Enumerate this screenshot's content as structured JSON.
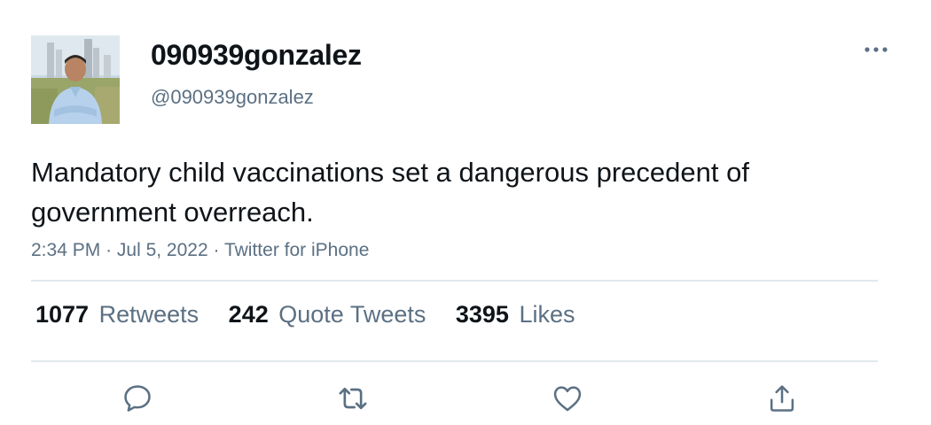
{
  "user": {
    "display_name": "090939gonzalez",
    "handle": "@090939gonzalez",
    "avatar_icon": "profile-photo"
  },
  "tweet": {
    "text": "Mandatory child vaccinations set a dangerous precedent of government overreach.",
    "time": "2:34 PM",
    "date": "Jul 5, 2022",
    "source": "Twitter for iPhone",
    "separator": "·"
  },
  "stats": {
    "retweets": {
      "count": "1077",
      "label": "Retweets"
    },
    "quotes": {
      "count": "242",
      "label": "Quote Tweets"
    },
    "likes": {
      "count": "3395",
      "label": "Likes"
    }
  },
  "actions": {
    "reply_icon": "reply-icon",
    "retweet_icon": "retweet-icon",
    "like_icon": "heart-icon",
    "share_icon": "share-icon",
    "more_icon": "more-icon"
  },
  "colors": {
    "text_primary": "#0f1419",
    "text_secondary": "#5b7083",
    "divider": "#e1e8ed",
    "icon": "#5b7083"
  }
}
